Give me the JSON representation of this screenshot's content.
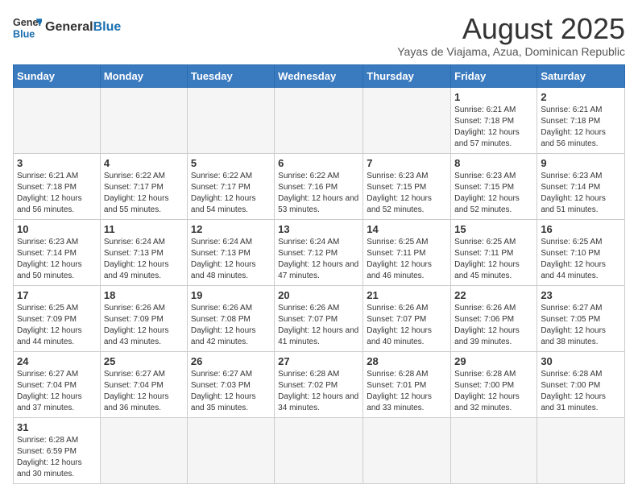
{
  "header": {
    "logo_general": "General",
    "logo_blue": "Blue",
    "month_year": "August 2025",
    "location": "Yayas de Viajama, Azua, Dominican Republic"
  },
  "weekdays": [
    "Sunday",
    "Monday",
    "Tuesday",
    "Wednesday",
    "Thursday",
    "Friday",
    "Saturday"
  ],
  "weeks": [
    [
      {
        "day": "",
        "info": ""
      },
      {
        "day": "",
        "info": ""
      },
      {
        "day": "",
        "info": ""
      },
      {
        "day": "",
        "info": ""
      },
      {
        "day": "",
        "info": ""
      },
      {
        "day": "1",
        "info": "Sunrise: 6:21 AM\nSunset: 7:18 PM\nDaylight: 12 hours\nand 57 minutes."
      },
      {
        "day": "2",
        "info": "Sunrise: 6:21 AM\nSunset: 7:18 PM\nDaylight: 12 hours\nand 56 minutes."
      }
    ],
    [
      {
        "day": "3",
        "info": "Sunrise: 6:21 AM\nSunset: 7:18 PM\nDaylight: 12 hours\nand 56 minutes."
      },
      {
        "day": "4",
        "info": "Sunrise: 6:22 AM\nSunset: 7:17 PM\nDaylight: 12 hours\nand 55 minutes."
      },
      {
        "day": "5",
        "info": "Sunrise: 6:22 AM\nSunset: 7:17 PM\nDaylight: 12 hours\nand 54 minutes."
      },
      {
        "day": "6",
        "info": "Sunrise: 6:22 AM\nSunset: 7:16 PM\nDaylight: 12 hours\nand 53 minutes."
      },
      {
        "day": "7",
        "info": "Sunrise: 6:23 AM\nSunset: 7:15 PM\nDaylight: 12 hours\nand 52 minutes."
      },
      {
        "day": "8",
        "info": "Sunrise: 6:23 AM\nSunset: 7:15 PM\nDaylight: 12 hours\nand 52 minutes."
      },
      {
        "day": "9",
        "info": "Sunrise: 6:23 AM\nSunset: 7:14 PM\nDaylight: 12 hours\nand 51 minutes."
      }
    ],
    [
      {
        "day": "10",
        "info": "Sunrise: 6:23 AM\nSunset: 7:14 PM\nDaylight: 12 hours\nand 50 minutes."
      },
      {
        "day": "11",
        "info": "Sunrise: 6:24 AM\nSunset: 7:13 PM\nDaylight: 12 hours\nand 49 minutes."
      },
      {
        "day": "12",
        "info": "Sunrise: 6:24 AM\nSunset: 7:13 PM\nDaylight: 12 hours\nand 48 minutes."
      },
      {
        "day": "13",
        "info": "Sunrise: 6:24 AM\nSunset: 7:12 PM\nDaylight: 12 hours\nand 47 minutes."
      },
      {
        "day": "14",
        "info": "Sunrise: 6:25 AM\nSunset: 7:11 PM\nDaylight: 12 hours\nand 46 minutes."
      },
      {
        "day": "15",
        "info": "Sunrise: 6:25 AM\nSunset: 7:11 PM\nDaylight: 12 hours\nand 45 minutes."
      },
      {
        "day": "16",
        "info": "Sunrise: 6:25 AM\nSunset: 7:10 PM\nDaylight: 12 hours\nand 44 minutes."
      }
    ],
    [
      {
        "day": "17",
        "info": "Sunrise: 6:25 AM\nSunset: 7:09 PM\nDaylight: 12 hours\nand 44 minutes."
      },
      {
        "day": "18",
        "info": "Sunrise: 6:26 AM\nSunset: 7:09 PM\nDaylight: 12 hours\nand 43 minutes."
      },
      {
        "day": "19",
        "info": "Sunrise: 6:26 AM\nSunset: 7:08 PM\nDaylight: 12 hours\nand 42 minutes."
      },
      {
        "day": "20",
        "info": "Sunrise: 6:26 AM\nSunset: 7:07 PM\nDaylight: 12 hours\nand 41 minutes."
      },
      {
        "day": "21",
        "info": "Sunrise: 6:26 AM\nSunset: 7:07 PM\nDaylight: 12 hours\nand 40 minutes."
      },
      {
        "day": "22",
        "info": "Sunrise: 6:26 AM\nSunset: 7:06 PM\nDaylight: 12 hours\nand 39 minutes."
      },
      {
        "day": "23",
        "info": "Sunrise: 6:27 AM\nSunset: 7:05 PM\nDaylight: 12 hours\nand 38 minutes."
      }
    ],
    [
      {
        "day": "24",
        "info": "Sunrise: 6:27 AM\nSunset: 7:04 PM\nDaylight: 12 hours\nand 37 minutes."
      },
      {
        "day": "25",
        "info": "Sunrise: 6:27 AM\nSunset: 7:04 PM\nDaylight: 12 hours\nand 36 minutes."
      },
      {
        "day": "26",
        "info": "Sunrise: 6:27 AM\nSunset: 7:03 PM\nDaylight: 12 hours\nand 35 minutes."
      },
      {
        "day": "27",
        "info": "Sunrise: 6:28 AM\nSunset: 7:02 PM\nDaylight: 12 hours\nand 34 minutes."
      },
      {
        "day": "28",
        "info": "Sunrise: 6:28 AM\nSunset: 7:01 PM\nDaylight: 12 hours\nand 33 minutes."
      },
      {
        "day": "29",
        "info": "Sunrise: 6:28 AM\nSunset: 7:00 PM\nDaylight: 12 hours\nand 32 minutes."
      },
      {
        "day": "30",
        "info": "Sunrise: 6:28 AM\nSunset: 7:00 PM\nDaylight: 12 hours\nand 31 minutes."
      }
    ],
    [
      {
        "day": "31",
        "info": "Sunrise: 6:28 AM\nSunset: 6:59 PM\nDaylight: 12 hours\nand 30 minutes."
      },
      {
        "day": "",
        "info": ""
      },
      {
        "day": "",
        "info": ""
      },
      {
        "day": "",
        "info": ""
      },
      {
        "day": "",
        "info": ""
      },
      {
        "day": "",
        "info": ""
      },
      {
        "day": "",
        "info": ""
      }
    ]
  ]
}
